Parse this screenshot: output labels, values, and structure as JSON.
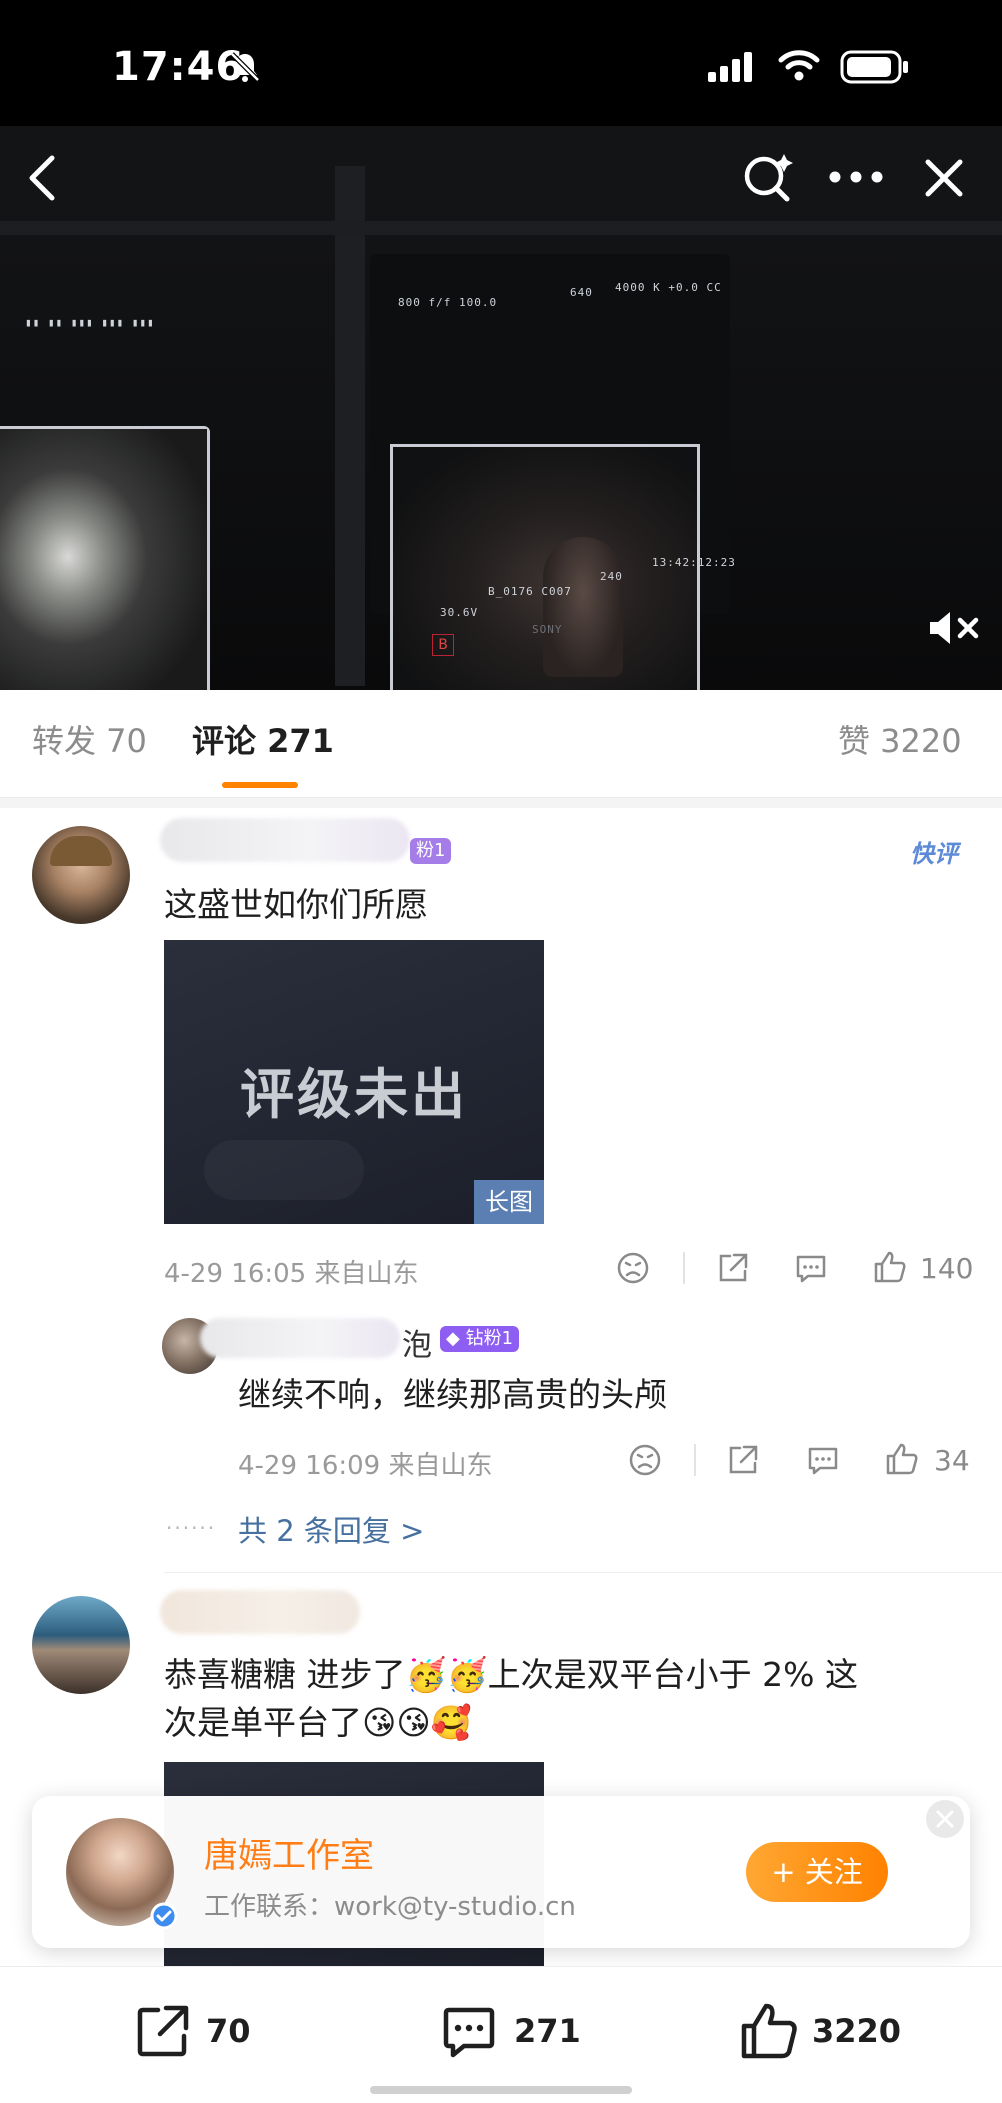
{
  "status_bar": {
    "time": "17:46"
  },
  "video": {
    "hud_top_left": "800   f/f 100.0",
    "hud_top_mid": "640",
    "hud_top_right": "4000 K  +0.0 CC",
    "hud_bottom_left": "B_0176  C007",
    "hud_bottom_mid": "240",
    "hud_bottom_right": "13:42:12:23",
    "hud_voltage": "30.6V",
    "brand": "SONY",
    "rec_tag": "B"
  },
  "tabs": {
    "repost": "转发 70",
    "comments": "评论 271",
    "likes": "赞 3220"
  },
  "comments": [
    {
      "badge": "粉1",
      "quick_label": "快评",
      "text": "这盛世如你们所愿",
      "image_text": "评级未出",
      "image_badge": "长图",
      "meta": "4-29 16:05  来自山东",
      "likes": "140",
      "reply": {
        "name_suffix": "泡",
        "badge": "钻粉1",
        "text": "继续不响，继续那高贵的头颅",
        "meta": "4-29 16:09  来自山东",
        "likes": "34"
      },
      "more_replies": "共 2 条回复 >"
    },
    {
      "text_line1": "恭喜糖糖 进步了🥳🥳上次是双平台小于 2% 这",
      "text_line2": "次是单平台了😘😘🥰"
    }
  ],
  "promo": {
    "name": "唐嫣工作室",
    "subtitle": "工作联系：work@ty-studio.cn",
    "follow": "+ 关注"
  },
  "bottom_bar": {
    "repost_count": "70",
    "comment_count": "271",
    "like_count": "3220"
  },
  "colors": {
    "accent": "#ff8200",
    "link": "#46709f",
    "fan_badge": "#8e5ef3"
  }
}
